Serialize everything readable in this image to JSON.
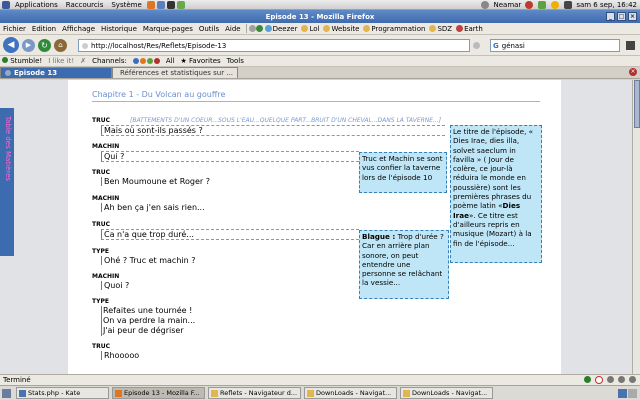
{
  "top_panel": {
    "menus": [
      "Applications",
      "Raccourcis",
      "Système"
    ],
    "user": "Neamar",
    "clock": "sam 6 sep, 16:42"
  },
  "window": {
    "title": "Episode 13 - Mozilla Firefox"
  },
  "menubar": {
    "items": [
      "Fichier",
      "Edition",
      "Affichage",
      "Historique",
      "Marque-pages",
      "Outils",
      "Aide"
    ],
    "bookmarks": [
      "Deezer",
      "Lol",
      "Website",
      "Programmation",
      "SDZ",
      "Earth"
    ]
  },
  "nav": {
    "url": "http://localhost/Res/Reflets/Episode-13",
    "search_value": "génasi"
  },
  "extbar": {
    "items": [
      "Stumble!",
      "I like it!",
      "Channels:",
      "All",
      "Favorites",
      "Tools"
    ]
  },
  "tabs": [
    {
      "label": "Episode 13",
      "active": true
    },
    {
      "label": "Références et statistiques sur ...",
      "active": false
    }
  ],
  "sidebar_tab": {
    "label": "Table des Matières"
  },
  "document": {
    "chapter_title": "Chapitre 1 - Du Volcan au gouffre",
    "stage_direction": "[BATTEMENTS D'UN COEUR...SOUS L'EAU...QUELQUE PART...BRUIT D'UN CHEVAL...DANS LA TAVERNE...]",
    "dialogue": [
      {
        "speaker": "TRUC",
        "lines": [
          "Mais où sont-ils passés ?"
        ]
      },
      {
        "speaker": "MACHIN",
        "lines": [
          "Qui ?"
        ]
      },
      {
        "speaker": "TRUC",
        "lines": [
          "Ben Moumoune et Roger ?"
        ]
      },
      {
        "speaker": "MACHIN",
        "lines": [
          "Ah ben ça j'en sais rien..."
        ]
      },
      {
        "speaker": "TRUC",
        "lines": [
          "Ca n'a que trop duré..."
        ]
      },
      {
        "speaker": "TYPE",
        "lines": [
          "Ohé ? Truc et machin ?"
        ]
      },
      {
        "speaker": "MACHIN",
        "lines": [
          "Quoi ?"
        ]
      },
      {
        "speaker": "TYPE",
        "lines": [
          "Refaites une tournée !",
          "On va perdre la main...",
          "J'ai peur de dégriser"
        ]
      },
      {
        "speaker": "TRUC",
        "lines": [
          "Rhooooo"
        ]
      }
    ],
    "notes": {
      "note1": "Truc et Machin se sont vus confier la taverne lors de l'épisode 10",
      "note2_bold": "Blague :",
      "note2_rest": " Trop d'urée ? Car en arrière plan sonore, on peut entendre une personne se relâchant la vessie...",
      "note3_pre": "Le titre de l'épisode, « Dies Irae, dies illa, solvet saeclum in favilla » ( Jour de colère, ce jour-là réduira le monde en poussière) sont les premières phrases du poème latin «",
      "note3_bold": "Dies Irae",
      "note3_post": "». Ce titre est d'ailleurs repris en musique (Mozart) à la fin de l'épisode..."
    }
  },
  "statusbar": {
    "text": "Terminé"
  },
  "taskbar": [
    {
      "label": "Stats.php - Kate",
      "active": false
    },
    {
      "label": "Episode 13 - Mozilla F...",
      "active": true
    },
    {
      "label": "Reflets - Navigateur d...",
      "active": false
    },
    {
      "label": "DownLoads - Navigat...",
      "active": false
    },
    {
      "label": "DownLoads - Navigat...",
      "active": false
    }
  ],
  "colors": {
    "accent": "#3d6bb0",
    "note_bg": "#bfe6f7",
    "chapter": "#6a8fd1"
  }
}
